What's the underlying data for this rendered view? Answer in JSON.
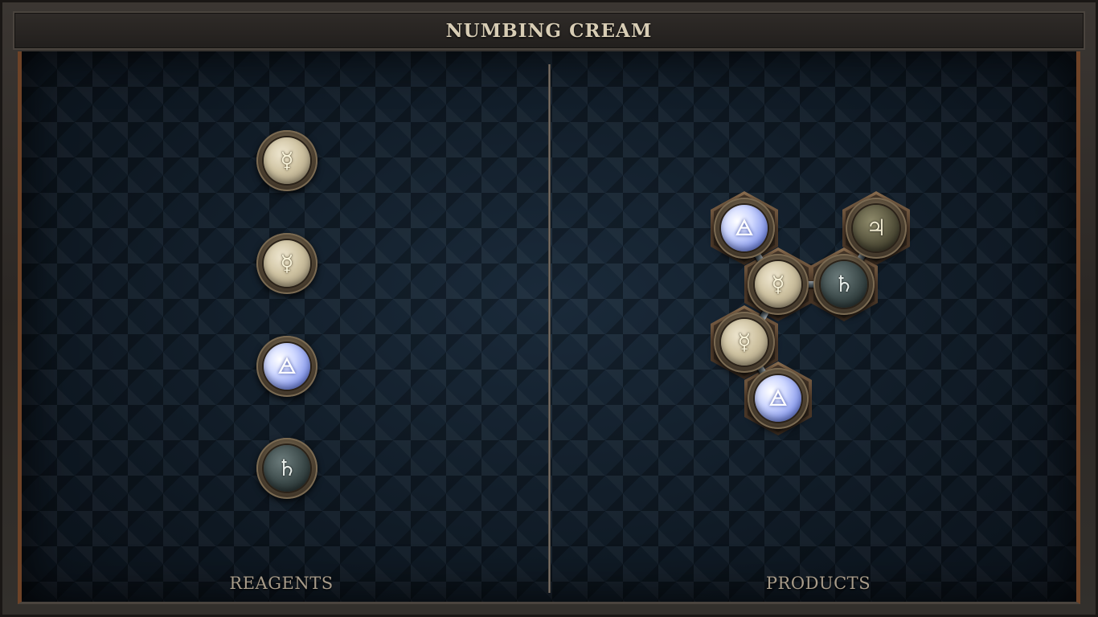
{
  "title": "NUMBING CREAM",
  "labels": {
    "reagents": "REAGENTS",
    "products": "PRODUCTS"
  },
  "glyphs": {
    "quicksilver": "☿",
    "air": "🜁",
    "lead": "♄",
    "tin": "♃"
  },
  "reagents": [
    {
      "element": "quicksilver",
      "glyph": "☿"
    },
    {
      "element": "quicksilver",
      "glyph": "☿"
    },
    {
      "element": "air",
      "glyph": "🜁"
    },
    {
      "element": "lead",
      "glyph": "♄"
    }
  ],
  "products": [
    {
      "element": "air",
      "glyph": "🜁"
    },
    {
      "element": "quicksilver",
      "glyph": "☿"
    },
    {
      "element": "lead",
      "glyph": "♄"
    },
    {
      "element": "tin",
      "glyph": "♃"
    },
    {
      "element": "quicksilver",
      "glyph": "☿"
    },
    {
      "element": "air",
      "glyph": "🜁"
    }
  ],
  "colors": {
    "accent_copper": "#6e4327",
    "title_text": "#d8cdb5",
    "label_text": "#a89c8a",
    "board_bg": "#0f1a24"
  }
}
